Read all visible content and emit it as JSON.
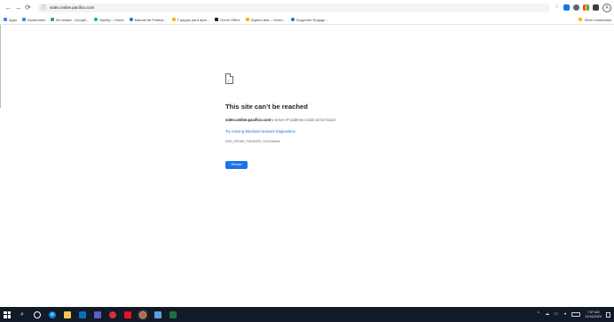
{
  "browser": {
    "nav": {
      "back_icon": "←",
      "forward_icon": "→",
      "reload_icon": "⟳"
    },
    "url": "video.online.pacifico.com",
    "extensions": [
      "star-icon",
      "extension-icon",
      "extension-icon",
      "extension-icon",
      "extension-icon",
      "profile-icon"
    ],
    "profile_initial": "A"
  },
  "bookmarks": {
    "items": [
      {
        "label": "Apps",
        "color": "#4285f4"
      },
      {
        "label": "Bookmarks",
        "color": "#4285f4"
      },
      {
        "label": "Mi unidad - Google...",
        "color": "#34a853"
      },
      {
        "label": "Spotify – Home",
        "color": "#1db954"
      },
      {
        "label": "Manual de Politica...",
        "color": "#1a73e8"
      },
      {
        "label": "7 juegos para apre...",
        "color": "#fbbc04"
      },
      {
        "label": "Home Office",
        "color": "#202124"
      },
      {
        "label": "Digital Labs – Home...",
        "color": "#f4b400"
      },
      {
        "label": "Supporter Engage...",
        "color": "#1a73e8"
      }
    ],
    "other": {
      "label": "Other bookmarks",
      "color": "#fbbc04"
    }
  },
  "error": {
    "title": "This site can’t be reached",
    "host": "video.online.pacifico.com",
    "description_suffix": "’s server IP address could not be found.",
    "try_link": "Try running Windows Network Diagnostics.",
    "code": "DNS_PROBE_FINISHED_NXDOMAIN",
    "reload_label": "Reload"
  },
  "taskbar": {
    "icons": [
      {
        "name": "search-icon",
        "glyph": "⌕",
        "color": ""
      },
      {
        "name": "task-view-icon",
        "glyph": "",
        "color": ""
      },
      {
        "name": "edge-icon",
        "glyph": "e",
        "color": "#0a84d6"
      },
      {
        "name": "file-explorer-icon",
        "glyph": "",
        "color": "#f2c94c"
      },
      {
        "name": "outlook-icon",
        "glyph": "",
        "color": "#0f6cbd"
      },
      {
        "name": "teams-icon",
        "glyph": "",
        "color": "#5b5fc7"
      },
      {
        "name": "app-red-icon",
        "glyph": "",
        "color": "#d13438"
      },
      {
        "name": "app-red2-icon",
        "glyph": "",
        "color": "#e81123"
      },
      {
        "name": "chrome-icon",
        "glyph": "",
        "color": "#ea4335"
      },
      {
        "name": "onedrive-icon",
        "glyph": "",
        "color": "#5aa0e0"
      },
      {
        "name": "excel-icon",
        "glyph": "",
        "color": "#1d6f42"
      }
    ],
    "clock": {
      "time": "7:57 AM",
      "date": "11/16/2020"
    }
  }
}
